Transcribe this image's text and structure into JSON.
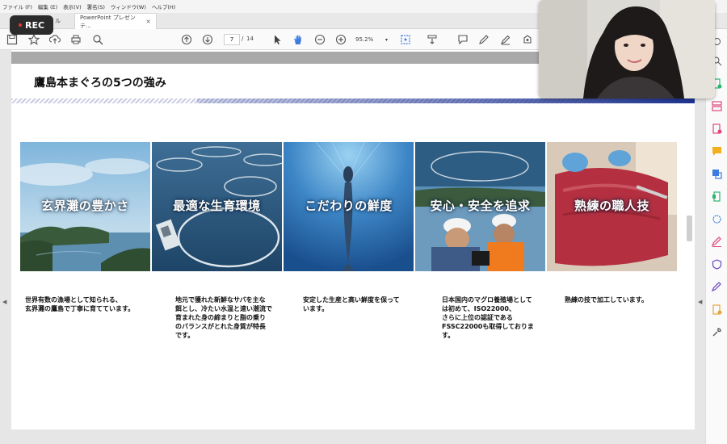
{
  "menu": [
    "ファイル (F)",
    "編集 (E)",
    "表示(V)",
    "署名(S)",
    "ウィンドウ(W)",
    "ヘルプ(H)"
  ],
  "tabs": {
    "home_label": "ホーム",
    "home_partial": "ル",
    "active_label": "PowerPoint プレゼンテ...",
    "close": "×"
  },
  "rec": {
    "label": "REC"
  },
  "toolbar": {
    "page_current": "7",
    "page_sep": "/",
    "page_total": "14",
    "zoom": "95.2%"
  },
  "slide": {
    "title": "鷹島本まぐろの5つの強み",
    "panels": [
      {
        "caption": "玄界灘の豊かさ",
        "text": [
          "世界有数の漁場として知られる、",
          "玄界灘の鷹島で丁寧に育てています。"
        ]
      },
      {
        "caption": "最適な生育環境",
        "text": [
          "地元で獲れた新鮮なサバを主な",
          "餌とし、冷たい水温と速い潮流で",
          "育まれた身の締まりと脂の乗り",
          "のバランスがとれた身質が特長",
          "です。"
        ]
      },
      {
        "caption": "こだわりの鮮度",
        "text": [
          "安定した生産と高い鮮度を保って",
          "います。"
        ]
      },
      {
        "caption": "安心・安全を追求",
        "text": [
          "日本国内のマグロ養殖場として",
          "は初めて、ISO22000、",
          "さらに上位の認証である",
          "FSSC22000も取得しておりま",
          "す。"
        ]
      },
      {
        "caption": "熟練の職人技",
        "text": [
          "熟練の技で加工しています。"
        ]
      }
    ]
  },
  "colors": {
    "accent_blue": "#1f3593",
    "rec_dot": "#e33333",
    "sidebar_icons": [
      "#4a90d9",
      "#e0457b",
      "#2bb673",
      "#e0457b",
      "#f2b01e",
      "#3d7be0",
      "#2bb673",
      "#3d7be0",
      "#e0457b",
      "#6b46c1",
      "#6b46c1",
      "#e8a33d",
      "#555555"
    ]
  }
}
